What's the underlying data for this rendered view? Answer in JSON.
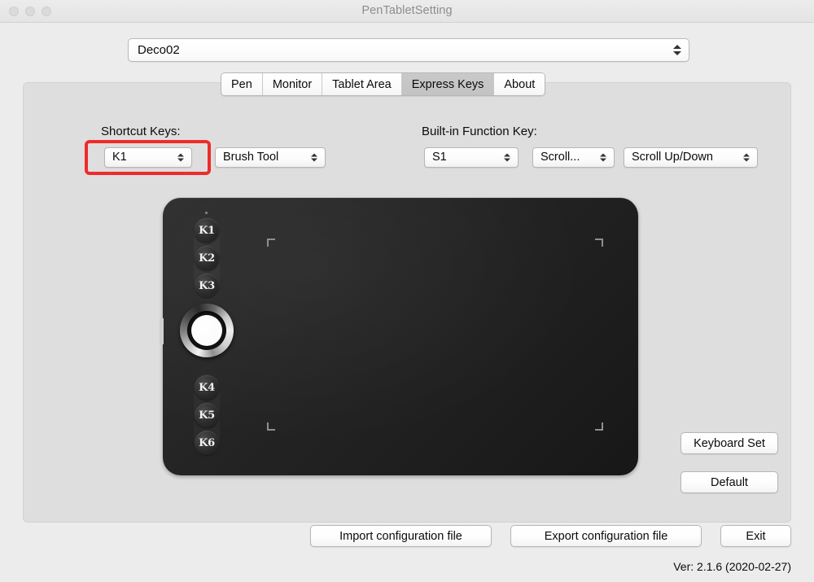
{
  "window": {
    "title": "PenTabletSetting",
    "traffic_lights": [
      "close-button",
      "minimize-button",
      "zoom-button"
    ]
  },
  "device_selector": {
    "value": "Deco02",
    "icon": "stepper-arrows-icon"
  },
  "tabs": [
    {
      "label": "Pen",
      "selected": false
    },
    {
      "label": "Monitor",
      "selected": false
    },
    {
      "label": "Tablet Area",
      "selected": false
    },
    {
      "label": "Express Keys",
      "selected": true
    },
    {
      "label": "About",
      "selected": false
    }
  ],
  "shortcut_keys": {
    "label": "Shortcut Keys:",
    "key_select": "K1",
    "function_select": "Brush Tool",
    "highlighted": true,
    "highlight_color": "#ef2b2b"
  },
  "builtin_function_key": {
    "label": "Built-in Function Key:",
    "key_select": "S1",
    "mode_select": "Scroll...",
    "action_select": "Scroll Up/Down"
  },
  "tablet": {
    "name": "deco02-tablet-illustration",
    "body_color": "#242424",
    "express_keys": [
      "K1",
      "K2",
      "K3",
      "K4",
      "K5",
      "K6"
    ],
    "ring": "scroll-ring",
    "corner_marks": 4,
    "led": "status-led"
  },
  "side_buttons": {
    "keyboard_set": "Keyboard Set",
    "default": "Default"
  },
  "bottom_buttons": {
    "import": "Import configuration file",
    "export": "Export configuration file",
    "exit": "Exit"
  },
  "footer": {
    "version": "Ver: 2.1.6 (2020-02-27)"
  }
}
